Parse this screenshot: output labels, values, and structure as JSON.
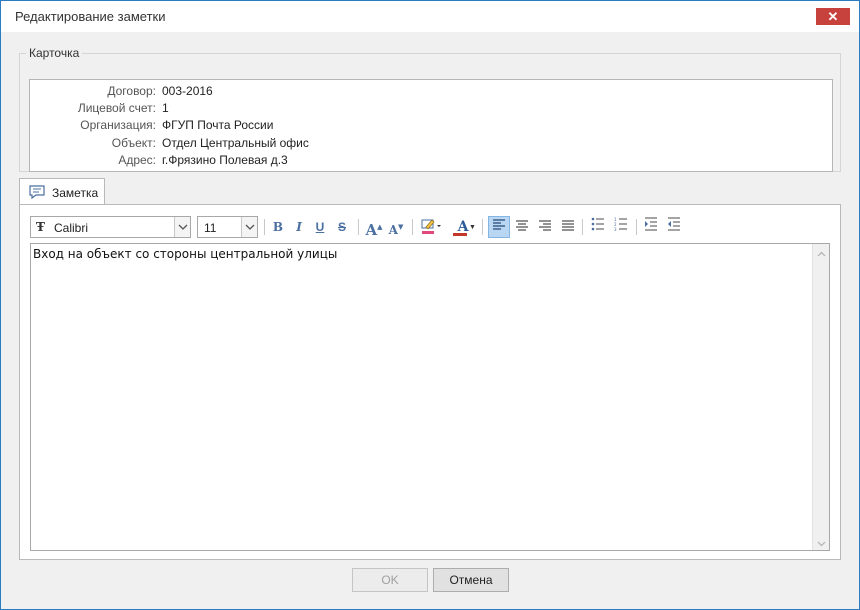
{
  "window": {
    "title": "Редактирование заметки",
    "close_glyph": "✕"
  },
  "card": {
    "legend": "Карточка",
    "fields": [
      {
        "label": "Договор:",
        "value": "003-2016"
      },
      {
        "label": "Лицевой счет:",
        "value": "1"
      },
      {
        "label": "Организация:",
        "value": "ФГУП Почта России"
      },
      {
        "label": "Объект:",
        "value": "Отдел Центральный офис"
      },
      {
        "label": "Адрес:",
        "value": "г.Фрязино Полевая д.3"
      }
    ]
  },
  "tab": {
    "label": "Заметка",
    "icon": "comment-icon"
  },
  "toolbar": {
    "font_name": "Calibri",
    "font_size": "11",
    "bold": "B",
    "italic": "I",
    "underline": "U",
    "strike": "S",
    "grow_font": "A",
    "shrink_font": "A",
    "font_color": "A"
  },
  "editor": {
    "text": "Вход на объект со стороны центральной улицы"
  },
  "buttons": {
    "ok": "OK",
    "cancel": "Отмена"
  },
  "colors": {
    "accent": "#2b7bc0",
    "close": "#c7423c",
    "active_tool": "#b9d7f3"
  }
}
